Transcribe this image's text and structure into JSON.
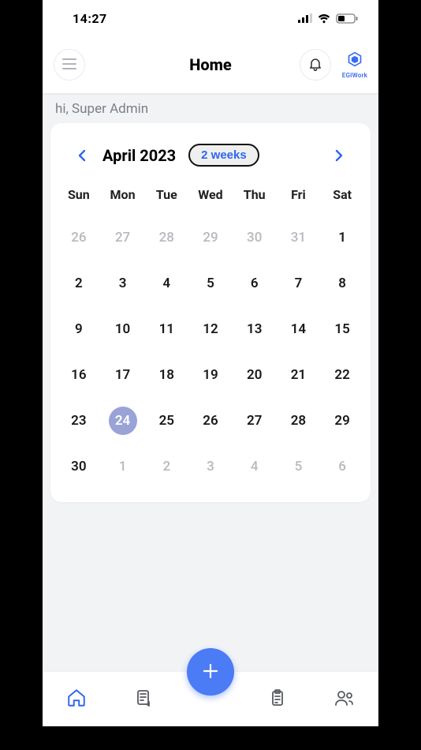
{
  "status": {
    "time": "14:27"
  },
  "nav": {
    "title": "Home",
    "brand_label": "EGIWork"
  },
  "greeting": "hi, Super Admin",
  "calendar": {
    "month_label": "April 2023",
    "range_label": "2 weeks",
    "dow": [
      "Sun",
      "Mon",
      "Tue",
      "Wed",
      "Thu",
      "Fri",
      "Sat"
    ],
    "cells": [
      {
        "d": "26",
        "out": true
      },
      {
        "d": "27",
        "out": true
      },
      {
        "d": "28",
        "out": true
      },
      {
        "d": "29",
        "out": true
      },
      {
        "d": "30",
        "out": true
      },
      {
        "d": "31",
        "out": true
      },
      {
        "d": "1"
      },
      {
        "d": "2"
      },
      {
        "d": "3"
      },
      {
        "d": "4"
      },
      {
        "d": "5"
      },
      {
        "d": "6"
      },
      {
        "d": "7"
      },
      {
        "d": "8"
      },
      {
        "d": "9"
      },
      {
        "d": "10"
      },
      {
        "d": "11"
      },
      {
        "d": "12"
      },
      {
        "d": "13"
      },
      {
        "d": "14"
      },
      {
        "d": "15"
      },
      {
        "d": "16"
      },
      {
        "d": "17"
      },
      {
        "d": "18"
      },
      {
        "d": "19"
      },
      {
        "d": "20"
      },
      {
        "d": "21"
      },
      {
        "d": "22"
      },
      {
        "d": "23"
      },
      {
        "d": "24",
        "selected": true
      },
      {
        "d": "25"
      },
      {
        "d": "26"
      },
      {
        "d": "27"
      },
      {
        "d": "28"
      },
      {
        "d": "29"
      },
      {
        "d": "30"
      },
      {
        "d": "1",
        "out": true
      },
      {
        "d": "2",
        "out": true
      },
      {
        "d": "3",
        "out": true
      },
      {
        "d": "4",
        "out": true
      },
      {
        "d": "5",
        "out": true
      },
      {
        "d": "6",
        "out": true
      }
    ]
  },
  "tabs": {
    "home_active": true
  }
}
